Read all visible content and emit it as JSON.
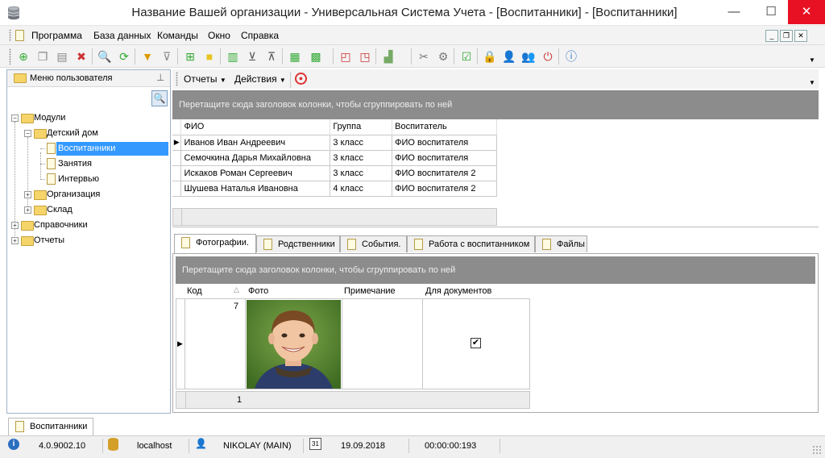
{
  "window": {
    "title": "Название Вашей организации - Универсальная Система Учета - [Воспитанники] - [Воспитанники]",
    "minimize": "—",
    "maximize": "☐",
    "close": "✕"
  },
  "menu": {
    "items": [
      "Программа",
      "База данных",
      "Команды",
      "Окно",
      "Справка"
    ]
  },
  "left_panel": {
    "title": "Меню пользователя",
    "tree": {
      "modules": "Модули",
      "orphanage": "Детский дом",
      "pupils": "Воспитанники",
      "lessons": "Занятия",
      "interview": "Интервью",
      "organization": "Организация",
      "warehouse": "Склад",
      "references": "Справочники",
      "reports": "Отчеты"
    }
  },
  "content_toolbar": {
    "reports": "Отчеты",
    "actions": "Действия"
  },
  "main_grid": {
    "group_hint": "Перетащите сюда заголовок колонки, чтобы сгруппировать по ней",
    "columns": [
      "ФИО",
      "Группа",
      "Воспитатель"
    ],
    "rows": [
      [
        "Иванов Иван Андреевич",
        "3 класс",
        "ФИО воспитателя"
      ],
      [
        "Семочкина Дарья Михайловна",
        "3 класс",
        "ФИО воспитателя"
      ],
      [
        "Искаков Роман Сергеевич",
        "3 класс",
        "ФИО воспитателя 2"
      ],
      [
        "Шушева Наталья Ивановна",
        "4 класс",
        "ФИО воспитателя 2"
      ]
    ]
  },
  "tabs": [
    "Фотографии.",
    "Родственники",
    "События.",
    "Работа с воспитанником",
    "Файлы"
  ],
  "photo_grid": {
    "group_hint": "Перетащите сюда заголовок колонки, чтобы сгруппировать по ней",
    "columns": [
      "Код",
      "Фото",
      "Примечание",
      "Для документов"
    ],
    "row": {
      "code": "7",
      "note": "",
      "for_documents": true
    },
    "footer_count": "1"
  },
  "document_tab": "Воспитанники",
  "status": {
    "version": "4.0.9002.10",
    "server": "localhost",
    "user": "NIKOLAY (MAIN)",
    "date": "19.09.2018",
    "timer": "00:00:00:193"
  }
}
